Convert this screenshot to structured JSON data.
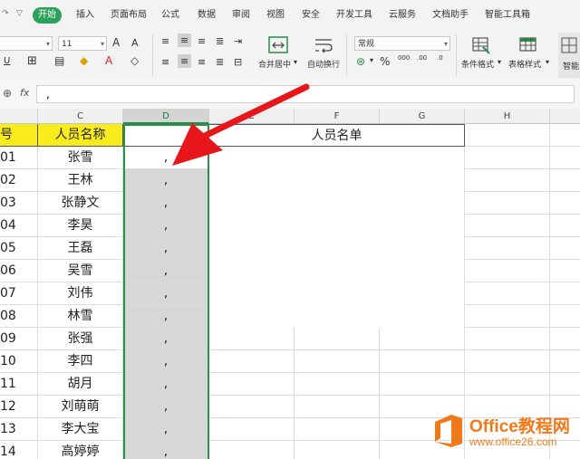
{
  "ribbon": {
    "tabs": [
      "开始",
      "插入",
      "页面布局",
      "公式",
      "数据",
      "审阅",
      "视图",
      "安全",
      "开发工具",
      "云服务",
      "文档助手",
      "智能工具箱"
    ],
    "font_size": "11",
    "increase_font": "A",
    "decrease_font": "A",
    "underline": "U",
    "merge_center": "合并居中",
    "wrap_text": "自动换行",
    "number_format": "常规",
    "percent": "%",
    "thousands": "000",
    "decimal_inc": ".00",
    "decimal_dec": ".0",
    "cond_format": "条件格式",
    "table_style": "表格样式",
    "smart": "智能",
    "accent_color": "#2aa25a"
  },
  "formula_bar": {
    "fx": "fx",
    "value": ","
  },
  "grid": {
    "columns": [
      "C",
      "D",
      "E",
      "F",
      "G",
      "H"
    ],
    "title_cell": "人员名单",
    "header": {
      "col_b": "号",
      "col_c": "人员名称",
      "col_d": ""
    },
    "rows": [
      {
        "num": "01",
        "name": "张雪",
        "d": ","
      },
      {
        "num": "02",
        "name": "王林",
        "d": ","
      },
      {
        "num": "03",
        "name": "张静文",
        "d": ","
      },
      {
        "num": "04",
        "name": "李昊",
        "d": ","
      },
      {
        "num": "05",
        "name": "王磊",
        "d": ","
      },
      {
        "num": "06",
        "name": "吴雪",
        "d": ","
      },
      {
        "num": "07",
        "name": "刘伟",
        "d": ","
      },
      {
        "num": "08",
        "name": "林雪",
        "d": ","
      },
      {
        "num": "09",
        "name": "张强",
        "d": ","
      },
      {
        "num": "10",
        "name": "李四",
        "d": ","
      },
      {
        "num": "11",
        "name": "胡月",
        "d": ","
      },
      {
        "num": "12",
        "name": "刘萌萌",
        "d": ","
      },
      {
        "num": "13",
        "name": "李大宝",
        "d": ","
      },
      {
        "num": "14",
        "name": "高婷婷",
        "d": ","
      }
    ]
  },
  "watermark": {
    "title": "Office教程网",
    "url": "www.office26.com",
    "color": "#f07a1a"
  }
}
